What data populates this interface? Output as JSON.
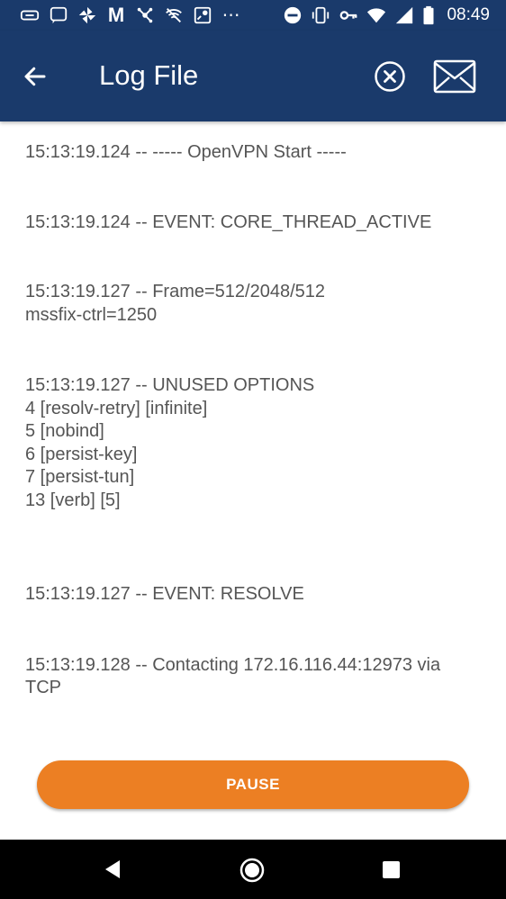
{
  "status_bar": {
    "time": "08:49",
    "left_icons": [
      "vpn-key-tag-icon",
      "chat-icon",
      "pinwheel-icon",
      "gmail-icon",
      "network-share-icon",
      "no-signal-icon",
      "map-icon",
      "more-dots-icon"
    ],
    "right_icons": [
      "do-not-disturb-icon",
      "vibrate-icon",
      "vpn-key-icon",
      "wifi-icon",
      "cell-signal-icon",
      "battery-icon"
    ]
  },
  "app_bar": {
    "title": "Log File",
    "background_color": "#1a3a6b"
  },
  "log_entries": [
    "15:13:19.124 -- ----- OpenVPN Start -----",
    "15:13:19.124 -- EVENT: CORE_THREAD_ACTIVE",
    "15:13:19.127 -- Frame=512/2048/512\nmssfix-ctrl=1250",
    "15:13:19.127 -- UNUSED OPTIONS\n4 [resolv-retry] [infinite]\n5 [nobind]\n6 [persist-key]\n7 [persist-tun]\n13 [verb] [5]",
    "15:13:19.127 -- EVENT: RESOLVE",
    "15:13:19.128 -- Contacting 172.16.116.44:12973 via\nTCP"
  ],
  "pause_button": {
    "label": "PAUSE",
    "color": "#ec7f23"
  }
}
